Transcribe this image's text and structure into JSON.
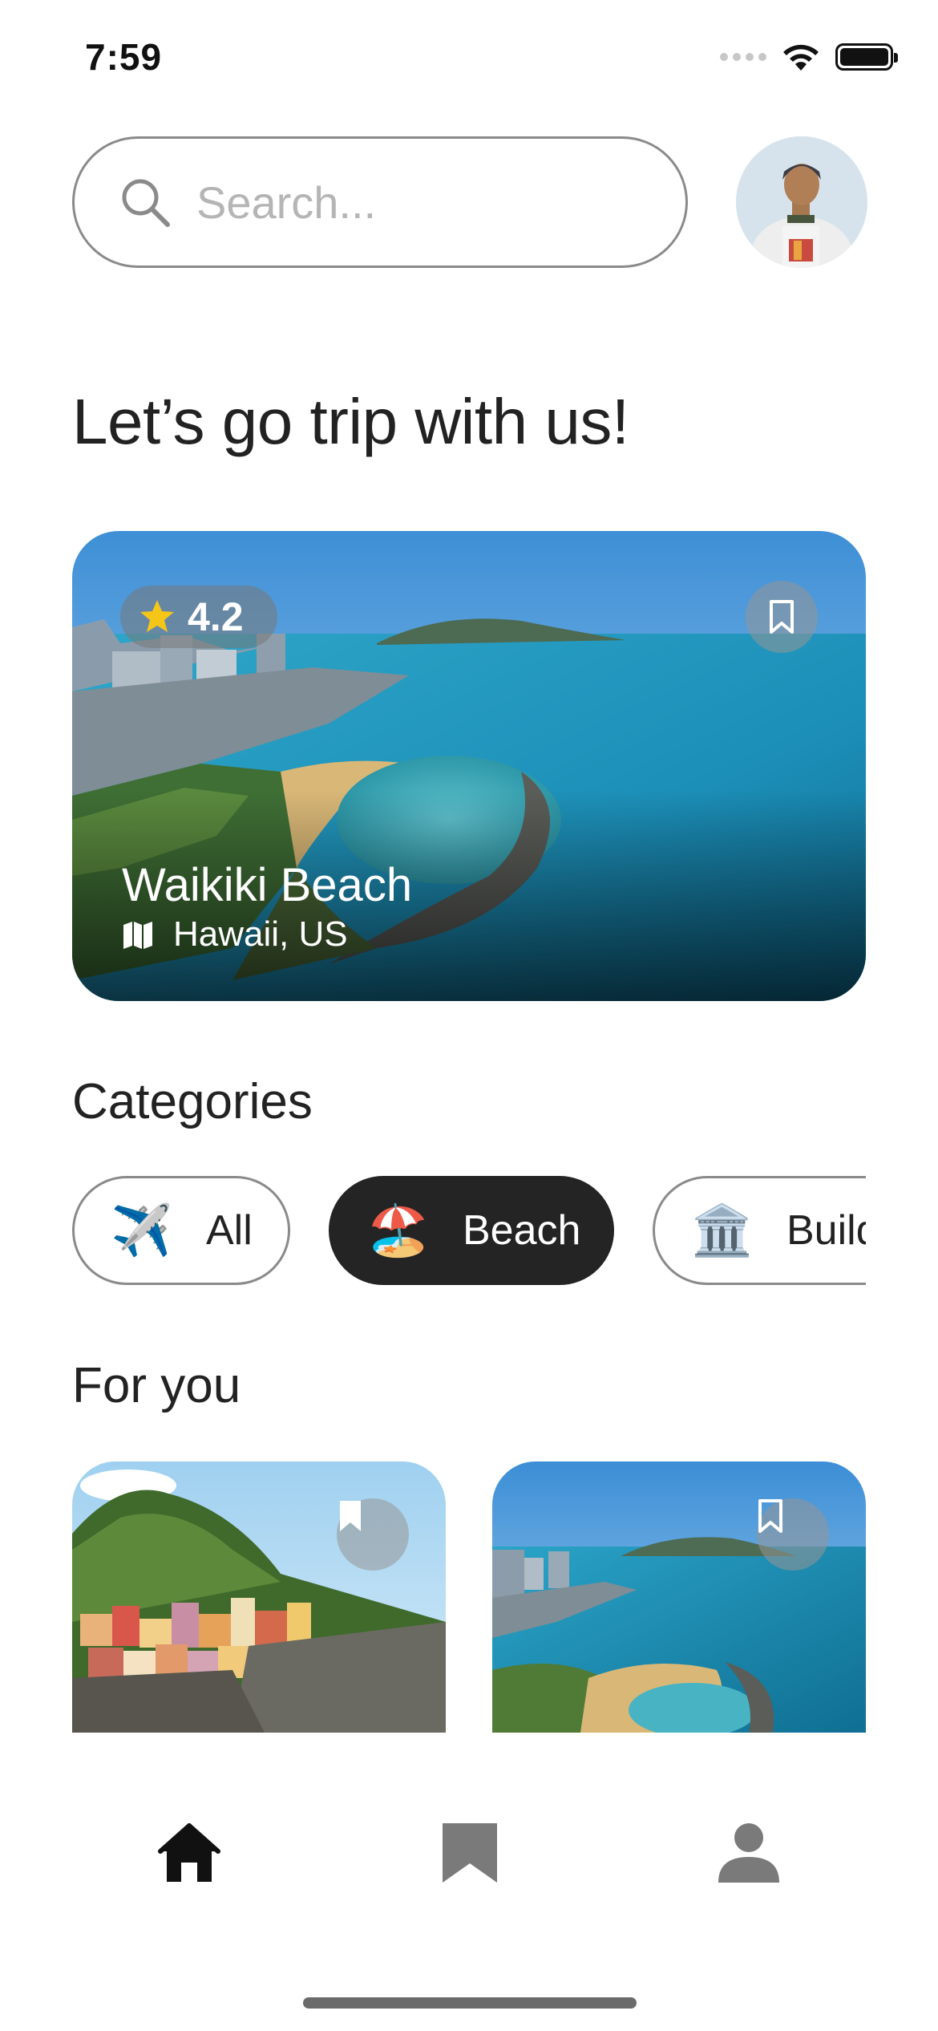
{
  "status_bar": {
    "time": "7:59",
    "icons": [
      "signal-dots",
      "wifi-icon",
      "battery-icon"
    ]
  },
  "search": {
    "placeholder": "Search...",
    "icon": "search-icon"
  },
  "profile": {
    "avatar": "user-photo"
  },
  "headline": "Let’s go trip with us!",
  "featured": {
    "title": "Waikiki Beach",
    "location": "Hawaii, US",
    "rating": "4.2",
    "rating_icon": "star-icon",
    "location_icon": "map-icon",
    "bookmark_icon": "bookmark-icon"
  },
  "categories": {
    "title": "Categories",
    "items": [
      {
        "emoji": "✈️",
        "label": "All",
        "active": false
      },
      {
        "emoji": "🏖️",
        "label": "Beach",
        "active": true
      },
      {
        "emoji": "🏛️",
        "label": "Buildings",
        "active": false
      }
    ]
  },
  "for_you": {
    "title": "For you",
    "cards": [
      {
        "image": "cinque-terre-village",
        "bookmark_icon": "bookmark-icon"
      },
      {
        "image": "waikiki-coastline",
        "bookmark_icon": "bookmark-icon"
      }
    ]
  },
  "tab_bar": {
    "items": [
      {
        "name": "home",
        "icon": "home-icon",
        "active": true
      },
      {
        "name": "saved",
        "icon": "bookmark-icon",
        "active": false
      },
      {
        "name": "profile",
        "icon": "person-icon",
        "active": false
      }
    ]
  },
  "colors": {
    "active_chip": "#242424",
    "star": "#f5c518",
    "inactive_icon": "#7a7a7a",
    "active_icon": "#111111",
    "border": "#8a8a8a"
  }
}
